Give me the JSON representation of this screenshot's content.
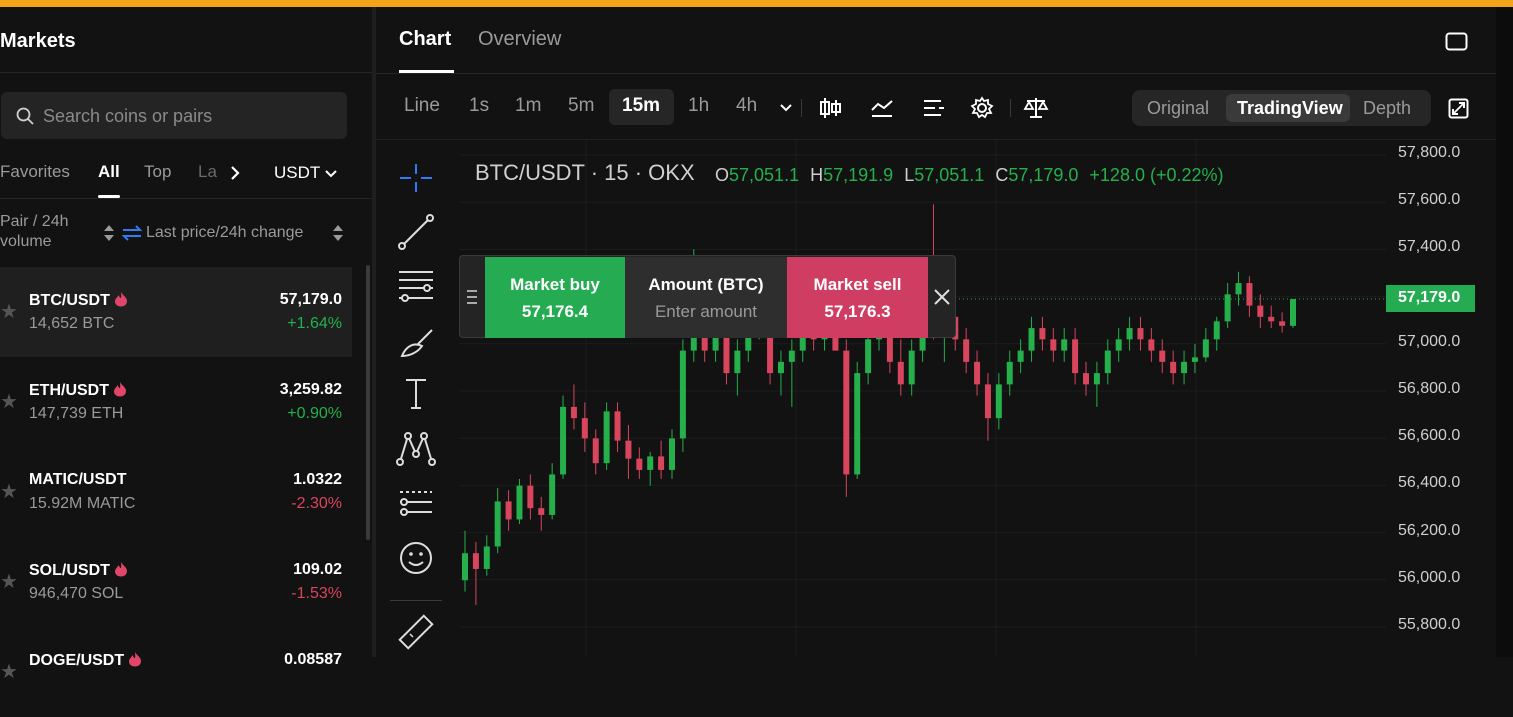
{
  "markets": {
    "title": "Markets",
    "search_placeholder": "Search coins or pairs",
    "tabs": [
      "Favorites",
      "All",
      "Top",
      "La"
    ],
    "quote_select": "USDT",
    "col_pair": "Pair / 24h",
    "col_volume": "volume",
    "col_price": "Last price/24h change",
    "rows": [
      {
        "pair": "BTC/USDT",
        "volume": "14,652 BTC",
        "price": "57,179.0",
        "change": "+1.64%",
        "dir": "up",
        "hot": true
      },
      {
        "pair": "ETH/USDT",
        "volume": "147,739 ETH",
        "price": "3,259.82",
        "change": "+0.90%",
        "dir": "up",
        "hot": true
      },
      {
        "pair": "MATIC/USDT",
        "volume": "15.92M MATIC",
        "price": "1.0322",
        "change": "-2.30%",
        "dir": "down",
        "hot": false
      },
      {
        "pair": "SOL/USDT",
        "volume": "946,470 SOL",
        "price": "109.02",
        "change": "-1.53%",
        "dir": "down",
        "hot": true
      },
      {
        "pair": "DOGE/USDT",
        "volume": "",
        "price": "0.08587",
        "change": "",
        "dir": "up",
        "hot": true
      }
    ]
  },
  "chart_tabs": [
    "Chart",
    "Overview"
  ],
  "timeframes": [
    "Line",
    "1s",
    "1m",
    "5m",
    "15m",
    "1h",
    "4h"
  ],
  "active_timeframe": "15m",
  "view_modes": [
    "Original",
    "TradingView",
    "Depth"
  ],
  "active_view": "TradingView",
  "symbol_line": "BTC/USDT · 15 · OKX",
  "ohlc": {
    "o_label": "O",
    "o": "57,051.1",
    "h_label": "H",
    "h": "57,191.9",
    "l_label": "L",
    "l": "57,051.1",
    "c_label": "C",
    "c": "57,179.0",
    "change": "+128.0 (+0.22%)"
  },
  "trade": {
    "buy_label": "Market buy",
    "buy_price": "57,176.4",
    "amount_label": "Amount (BTC)",
    "amount_placeholder": "Enter amount",
    "sell_label": "Market sell",
    "sell_price": "57,176.3"
  },
  "y_axis": [
    "57,800.0",
    "57,600.0",
    "57,400.0",
    "57,200.0",
    "57,000.0",
    "56,800.0",
    "56,600.0",
    "56,400.0",
    "56,200.0",
    "56,000.0",
    "55,800.0"
  ],
  "last_price": "57,179.0",
  "colors": {
    "up": "#25b04b",
    "down": "#d8455d",
    "accent": "#f2a51a"
  },
  "chart_data": {
    "type": "candlestick",
    "ylim": [
      55700,
      57850
    ],
    "candles": [
      [
        55930,
        56150,
        55880,
        56050
      ],
      [
        56050,
        56100,
        55820,
        55980
      ],
      [
        55980,
        56130,
        55950,
        56080
      ],
      [
        56080,
        56340,
        56050,
        56280
      ],
      [
        56280,
        56330,
        56150,
        56200
      ],
      [
        56200,
        56380,
        56180,
        56350
      ],
      [
        56350,
        56400,
        56200,
        56250
      ],
      [
        56250,
        56300,
        56150,
        56220
      ],
      [
        56220,
        56450,
        56200,
        56400
      ],
      [
        56400,
        56750,
        56380,
        56700
      ],
      [
        56700,
        56800,
        56600,
        56650
      ],
      [
        56650,
        56720,
        56500,
        56560
      ],
      [
        56560,
        56600,
        56400,
        56450
      ],
      [
        56450,
        56720,
        56420,
        56680
      ],
      [
        56680,
        56720,
        56500,
        56550
      ],
      [
        56550,
        56620,
        56380,
        56470
      ],
      [
        56470,
        56520,
        56380,
        56420
      ],
      [
        56420,
        56500,
        56350,
        56480
      ],
      [
        56480,
        56550,
        56380,
        56420
      ],
      [
        56420,
        56600,
        56380,
        56560
      ],
      [
        56560,
        57000,
        56500,
        56950
      ],
      [
        56950,
        57400,
        56900,
        57300
      ],
      [
        57300,
        57350,
        56900,
        56950
      ],
      [
        56950,
        57250,
        56900,
        57200
      ],
      [
        57200,
        57220,
        56800,
        56850
      ],
      [
        56850,
        57000,
        56750,
        56950
      ],
      [
        56950,
        57150,
        56900,
        57100
      ],
      [
        57100,
        57250,
        57000,
        57200
      ],
      [
        57200,
        57250,
        56800,
        56850
      ],
      [
        56850,
        56950,
        56750,
        56900
      ],
      [
        56900,
        57000,
        56700,
        56950
      ],
      [
        56950,
        57100,
        56900,
        57050
      ],
      [
        57050,
        57080,
        56950,
        57000
      ],
      [
        57000,
        57100,
        56950,
        57050
      ],
      [
        57050,
        57150,
        56950,
        56950
      ],
      [
        56950,
        57000,
        56300,
        56400
      ],
      [
        56400,
        56900,
        56380,
        56850
      ],
      [
        56850,
        57050,
        56800,
        57000
      ],
      [
        57000,
        57100,
        56950,
        57050
      ],
      [
        57050,
        57150,
        56850,
        56900
      ],
      [
        56900,
        57000,
        56750,
        56800
      ],
      [
        56800,
        57000,
        56750,
        56950
      ],
      [
        56950,
        57300,
        56900,
        57250
      ],
      [
        57250,
        57600,
        57000,
        57050
      ],
      [
        57050,
        57150,
        56900,
        57100
      ],
      [
        57100,
        57150,
        56950,
        57000
      ],
      [
        57000,
        57050,
        56850,
        56900
      ],
      [
        56900,
        56950,
        56750,
        56800
      ],
      [
        56800,
        56850,
        56550,
        56650
      ],
      [
        56650,
        56850,
        56600,
        56800
      ],
      [
        56800,
        56950,
        56750,
        56900
      ],
      [
        56900,
        57000,
        56850,
        56950
      ],
      [
        56950,
        57100,
        56900,
        57050
      ],
      [
        57050,
        57100,
        56950,
        57000
      ],
      [
        57000,
        57050,
        56900,
        56950
      ],
      [
        56950,
        57050,
        56900,
        57000
      ],
      [
        57000,
        57050,
        56800,
        56850
      ],
      [
        56850,
        56900,
        56750,
        56800
      ],
      [
        56800,
        56900,
        56700,
        56850
      ],
      [
        56850,
        57000,
        56800,
        56950
      ],
      [
        56950,
        57050,
        56900,
        57000
      ],
      [
        57000,
        57100,
        56950,
        57050
      ],
      [
        57050,
        57100,
        56950,
        57000
      ],
      [
        57000,
        57050,
        56900,
        56950
      ],
      [
        56950,
        57000,
        56850,
        56900
      ],
      [
        56900,
        56950,
        56800,
        56850
      ],
      [
        56850,
        56950,
        56800,
        56900
      ],
      [
        56900,
        56980,
        56850,
        56920
      ],
      [
        56920,
        57050,
        56900,
        57000
      ],
      [
        57000,
        57100,
        56950,
        57080
      ],
      [
        57080,
        57250,
        57050,
        57200
      ],
      [
        57200,
        57300,
        57150,
        57250
      ],
      [
        57250,
        57280,
        57100,
        57150
      ],
      [
        57150,
        57200,
        57050,
        57100
      ],
      [
        57100,
        57150,
        57050,
        57080
      ],
      [
        57080,
        57120,
        57030,
        57060
      ],
      [
        57060,
        57179,
        57051,
        57179
      ]
    ]
  }
}
